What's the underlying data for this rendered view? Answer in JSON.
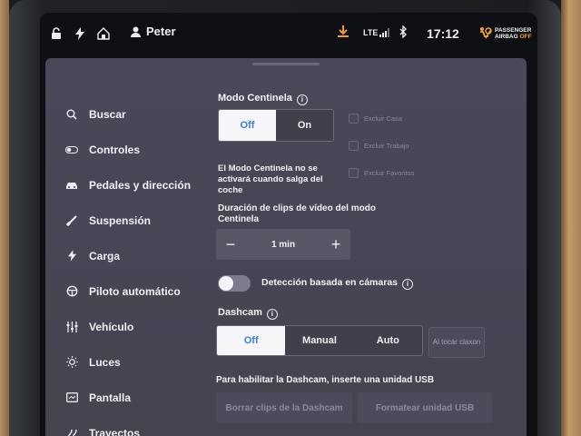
{
  "status_bar": {
    "user": "Peter",
    "network": "LTE",
    "time": "17:12",
    "airbag_line1": "PASSENGER",
    "airbag_line2": "AIRBAG",
    "airbag_line3": "OFF"
  },
  "sidebar": {
    "items": [
      {
        "label": "Buscar",
        "icon": "search-icon"
      },
      {
        "label": "Controles",
        "icon": "toggle-icon"
      },
      {
        "label": "Pedales y dirección",
        "icon": "car-icon"
      },
      {
        "label": "Suspensión",
        "icon": "suspension-icon"
      },
      {
        "label": "Carga",
        "icon": "bolt-icon"
      },
      {
        "label": "Piloto automático",
        "icon": "steering-wheel-icon"
      },
      {
        "label": "Vehículo",
        "icon": "sliders-icon"
      },
      {
        "label": "Luces",
        "icon": "sun-icon"
      },
      {
        "label": "Pantalla",
        "icon": "display-icon"
      },
      {
        "label": "Trayectos",
        "icon": "trips-icon"
      }
    ]
  },
  "sentry": {
    "title": "Modo Centinela",
    "options": [
      "Off",
      "On"
    ],
    "selected": "Off",
    "description": "El Modo Centinela no se activará cuando salga del coche",
    "exclusions": [
      "Excluir Casa",
      "Excluir Trabajo",
      "Excluir Favoritos"
    ],
    "clip_duration_label": "Duración de clips de vídeo del modo Centinela",
    "clip_duration_value": "1 min",
    "camera_detection_label": "Detección basada en cámaras",
    "camera_detection_on": false
  },
  "dashcam": {
    "title": "Dashcam",
    "options": [
      "Off",
      "Manual",
      "Auto"
    ],
    "selected": "Off",
    "side_button": "Al tocar claxon",
    "usb_note": "Para habilitar la Dashcam, inserte una unidad USB",
    "delete_button": "Borrar clips de la Dashcam",
    "format_button": "Formatear unidad USB"
  },
  "colors": {
    "accent": "#3f7be0",
    "panel_bg": "#4a4858",
    "download_orange": "#f39a2b"
  }
}
